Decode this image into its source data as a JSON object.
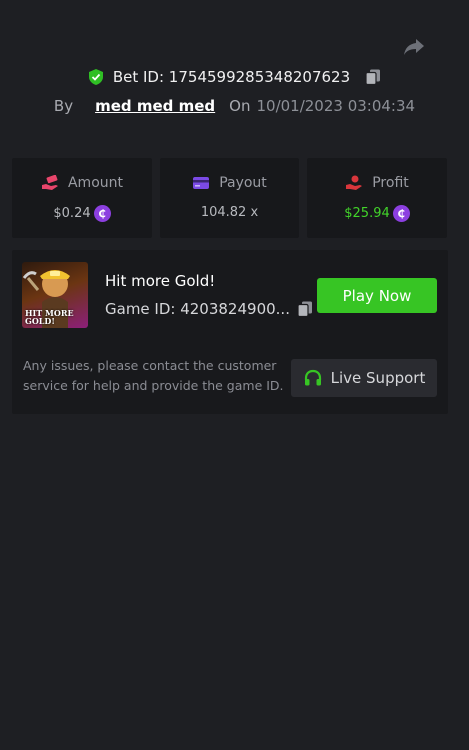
{
  "header": {
    "bet_id_label": "Bet ID: 1754599285348207623",
    "by_label": "By",
    "username": "med med med",
    "on_label": "On",
    "datetime": "10/01/2023 03:04:34"
  },
  "stats": {
    "amount": {
      "label": "Amount",
      "value": "$0.24",
      "icon": "money-hand-icon"
    },
    "payout": {
      "label": "Payout",
      "value": "104.82 x",
      "icon": "card-icon"
    },
    "profit": {
      "label": "Profit",
      "value": "$25.94",
      "icon": "profit-hand-icon"
    }
  },
  "currency_symbol": "₵",
  "game": {
    "title": "Hit more Gold!",
    "thumbnail_text": "HIT MORE\nGOLD!",
    "id_label": "Game ID: 4203824900...",
    "play_label": "Play Now"
  },
  "support": {
    "text": "Any issues, please contact the customer service for help and provide the game ID.",
    "button_label": "Live Support"
  },
  "colors": {
    "background": "#1e1f23",
    "card": "#17181b",
    "accent_green": "#37c524",
    "profit_green": "#42d42a",
    "coin_purple": "#8c3fe0",
    "payout_purple": "#7b4ae6",
    "amount_pink": "#e8456b",
    "profit_red": "#d9363c"
  }
}
